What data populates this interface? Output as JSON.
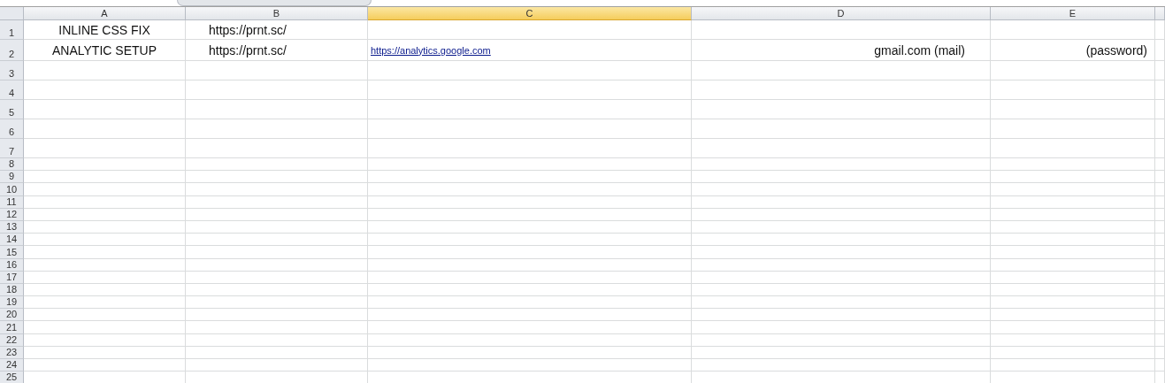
{
  "columns": [
    {
      "label": "A",
      "selected": false
    },
    {
      "label": "B",
      "selected": false
    },
    {
      "label": "C",
      "selected": true
    },
    {
      "label": "D",
      "selected": false
    },
    {
      "label": "E",
      "selected": false
    }
  ],
  "rows": [
    {
      "label": "1",
      "cells": [
        {
          "kind": "text",
          "text": "INLINE CSS FIX"
        },
        {
          "kind": "text",
          "text": "https://prnt.sc/"
        }
      ]
    },
    {
      "label": "2",
      "cells": [
        {
          "kind": "text",
          "text": "ANALYTIC SETUP"
        },
        {
          "kind": "text",
          "text": "https://prnt.sc/"
        },
        {
          "kind": "link",
          "text": "https://analytics.google.com"
        },
        {
          "kind": "text",
          "text": "gmail.com (mail)"
        },
        {
          "kind": "text",
          "text": "(password)"
        }
      ]
    },
    {
      "label": "3"
    },
    {
      "label": "4"
    },
    {
      "label": "5"
    },
    {
      "label": "6"
    },
    {
      "label": "7"
    },
    {
      "label": "8"
    },
    {
      "label": "9"
    },
    {
      "label": "10"
    },
    {
      "label": "11"
    },
    {
      "label": "12"
    },
    {
      "label": "13"
    },
    {
      "label": "14"
    },
    {
      "label": "15"
    },
    {
      "label": "16"
    },
    {
      "label": "17"
    },
    {
      "label": "18"
    },
    {
      "label": "19"
    },
    {
      "label": "20"
    },
    {
      "label": "21"
    },
    {
      "label": "22"
    },
    {
      "label": "23"
    },
    {
      "label": "24"
    },
    {
      "label": "25"
    }
  ]
}
